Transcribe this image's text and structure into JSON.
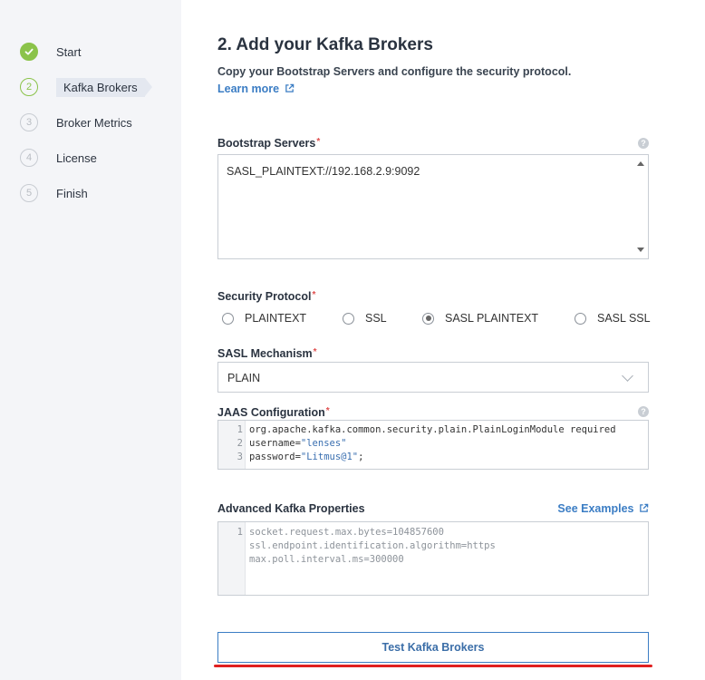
{
  "sidebar": {
    "steps": [
      {
        "marker": "",
        "label": "Start",
        "state": "done"
      },
      {
        "marker": "2",
        "label": "Kafka Brokers",
        "state": "active"
      },
      {
        "marker": "3",
        "label": "Broker Metrics",
        "state": "pending"
      },
      {
        "marker": "4",
        "label": "License",
        "state": "pending"
      },
      {
        "marker": "5",
        "label": "Finish",
        "state": "pending"
      }
    ]
  },
  "main": {
    "title": "2. Add your Kafka Brokers",
    "subtitle": "Copy your Bootstrap Servers and configure the security protocol.",
    "learn_more": "Learn more",
    "bootstrap": {
      "label": "Bootstrap Servers",
      "required": "*",
      "value": "SASL_PLAINTEXT://192.168.2.9:9092"
    },
    "security_protocol": {
      "label": "Security Protocol",
      "required": "*",
      "options": [
        {
          "label": "PLAINTEXT",
          "checked": false
        },
        {
          "label": "SSL",
          "checked": false
        },
        {
          "label": "SASL PLAINTEXT",
          "checked": true
        },
        {
          "label": "SASL SSL",
          "checked": false
        }
      ]
    },
    "sasl_mechanism": {
      "label": "SASL Mechanism",
      "required": "*",
      "value": "PLAIN"
    },
    "jaas": {
      "label": "JAAS Configuration",
      "required": "*",
      "lines": [
        {
          "n": "1",
          "text": "org.apache.kafka.common.security.plain.PlainLoginModule required"
        },
        {
          "n": "2",
          "key": "username=",
          "str": "\"lenses\""
        },
        {
          "n": "3",
          "key": "password=",
          "str": "\"Litmus@1\"",
          "tail": ";"
        }
      ]
    },
    "advanced": {
      "label": "Advanced Kafka Properties",
      "see_examples": "See Examples",
      "gutter": "1",
      "placeholder_lines": [
        "socket.request.max.bytes=104857600",
        "ssl.endpoint.identification.algorithm=https",
        "max.poll.interval.ms=300000"
      ]
    },
    "test_button": "Test Kafka Brokers"
  },
  "icons": {
    "help": "?",
    "check": "check-icon",
    "external": "external-link-icon"
  },
  "colors": {
    "accent": "#3b7dc4",
    "success": "#8bc34a",
    "required": "#e05050",
    "highlight": "#e02020"
  }
}
